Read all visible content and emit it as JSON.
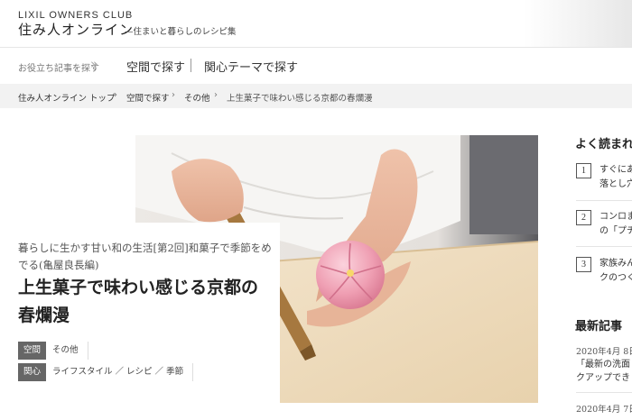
{
  "header": {
    "brand_top": "LIXIL OWNERS CLUB",
    "brand_name": "住み人オンライン",
    "brand_tagline": "—住まいと暮らしのレシピ集"
  },
  "nav": {
    "hint": "お役立ち記事を探す",
    "hint_icon": "double-chevron-right",
    "items": [
      "空間で探す",
      "関心テーマで探す"
    ]
  },
  "breadcrumb": {
    "items": [
      "住み人オンライン トップ",
      "空間で探す",
      "その他",
      "上生菓子で味わい感じる京都の春爛漫"
    ],
    "separator": "›"
  },
  "article": {
    "subtitle": "暮らしに生かす甘い和の生活[第2回]和菓子で季節をめでる(亀屋良長編)",
    "title": "上生菓子で味わい感じる京都の春爛漫",
    "tags": [
      {
        "label": "空間",
        "value": "その他"
      },
      {
        "label": "関心",
        "value": "ライフスタイル ／ レシピ ／ 季節"
      }
    ]
  },
  "sidebar": {
    "popular_title": "よく読まれ",
    "popular": [
      {
        "rank": "1",
        "line1": "すぐにあ",
        "line2": "落とし穴"
      },
      {
        "rank": "2",
        "line1": "コンロま",
        "line2": "の「プチ"
      },
      {
        "rank": "3",
        "line1": "家族みん",
        "line2": "クのつく"
      }
    ],
    "latest_title": "最新記事",
    "latest": [
      {
        "date": "2020年4月 8日",
        "line1": "「最新の洗面",
        "line2": "クアップでき"
      },
      {
        "date": "2020年4月 7日"
      }
    ]
  },
  "colors": {
    "tag_bg": "#666666",
    "breadcrumb_bg": "#f2f2f2",
    "wagashi_pink": "#e98fa6"
  }
}
